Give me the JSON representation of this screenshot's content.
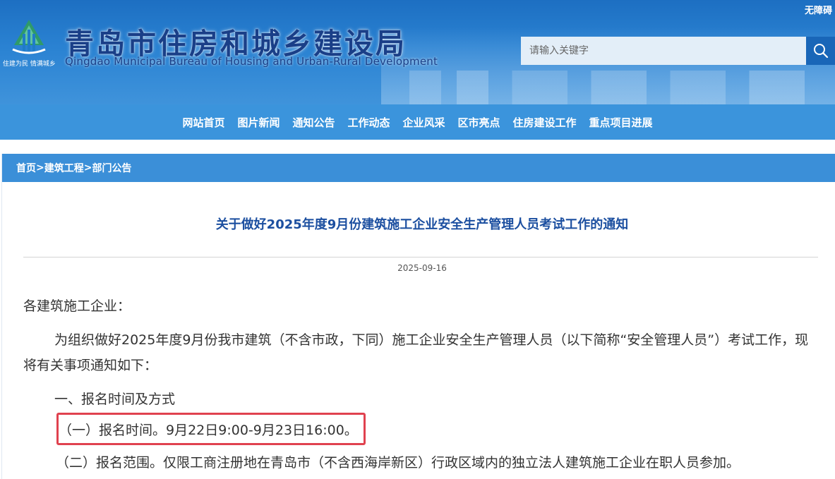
{
  "header": {
    "accessibility_label": "无障碍",
    "slogan": "住建为民 情满城乡",
    "title": "青岛市住房和城乡建设局",
    "subtitle": "Qingdao Municipal Bureau of Housing and Urban-Rural Development",
    "search_placeholder": "请输入关键字"
  },
  "nav": {
    "items": [
      "网站首页",
      "图片新闻",
      "通知公告",
      "工作动态",
      "企业风采",
      "区市亮点",
      "住房建设工作",
      "重点项目进展"
    ]
  },
  "breadcrumb": {
    "items": [
      "首页",
      "建筑工程",
      "部门公告"
    ],
    "separator": ">"
  },
  "article": {
    "title": "关于做好2025年度9月份建筑施工企业安全生产管理人员考试工作的通知",
    "date": "2025-09-16",
    "salutation": "各建筑施工企业：",
    "para1": "为组织做好2025年度9月份我市建筑（不含市政，下同）施工企业安全生产管理人员（以下简称“安全管理人员”）考试工作，现将有关事项通知如下：",
    "section1": "一、报名时间及方式",
    "item1": "（一）报名时间。9月22日9:00-9月23日16:00。",
    "item2": "（二）报名范围。仅限工商注册地在青岛市（不含西海岸新区）行政区域内的独立法人建筑施工企业在职人员参加。"
  },
  "colors": {
    "header_blue": "#2a82d2",
    "nav_blue": "#3b94dc",
    "title_blue": "#1c4fa0",
    "highlight_red": "#e0424f"
  },
  "icons": {
    "logo": "bureau-logo-icon",
    "search": "search-icon"
  }
}
